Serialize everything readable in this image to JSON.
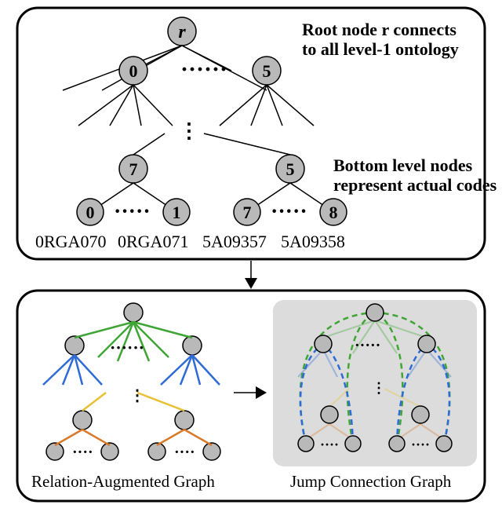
{
  "topPanel": {
    "root": "r",
    "level1_left": "0",
    "level1_right": "5",
    "leaf_parent_left": "7",
    "leaf_parent_right": "5",
    "leaf_ll": "0",
    "leaf_lr": "1",
    "leaf_rl": "7",
    "leaf_rr": "8",
    "code_ll": "0RGA070",
    "code_lr": "0RGA071",
    "code_rl": "5A09357",
    "code_rr": "5A09358",
    "caption_root_1": "Root node r connects",
    "caption_root_2": "to all level-1 ontology",
    "caption_leaf_1": "Bottom level nodes",
    "caption_leaf_2": "represent actual codes"
  },
  "bottomPanel": {
    "left_caption": "Relation-Augmented Graph",
    "right_caption": "Jump Connection Graph"
  },
  "colors": {
    "green": "#3fa535",
    "blue": "#2f6bd6",
    "yellow": "#e8c035",
    "orange": "#d87a2a",
    "jump_green": "#3fa535",
    "jump_blue": "#2f6bd6",
    "jump_yellow": "#e8c035",
    "jump_orange": "#d87a2a",
    "node_fill": "#b9b9b9",
    "jump_bg": "#dcdcdc"
  }
}
